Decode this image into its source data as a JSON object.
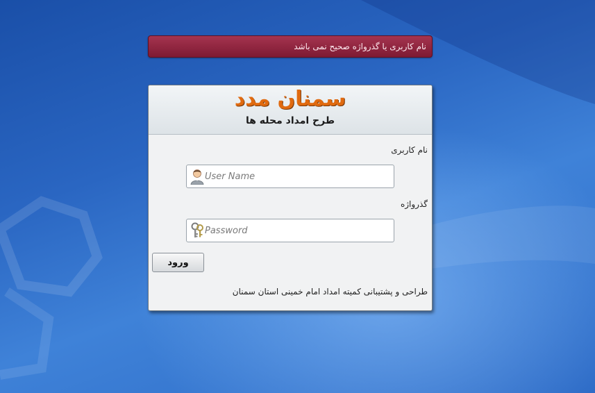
{
  "error": {
    "message": "نام کاربری یا گذرواژه صحیح نمی باشد"
  },
  "header": {
    "logo_text": "سمنان مدد",
    "subtitle": "طرح امداد محله ها"
  },
  "form": {
    "username_label": "نام کاربری",
    "username_placeholder": "User Name",
    "username_icon": "user-icon",
    "password_label": "گذرواژه",
    "password_placeholder": "Password",
    "password_icon": "keys-icon",
    "submit_label": "ورود"
  },
  "footer": {
    "credit": "طراحی و پشتیبانی کمیته امداد امام خمینی استان سمنان"
  },
  "colors": {
    "error_bg": "#8f2440",
    "logo": "#e06a10",
    "background": "#2a66c2"
  }
}
